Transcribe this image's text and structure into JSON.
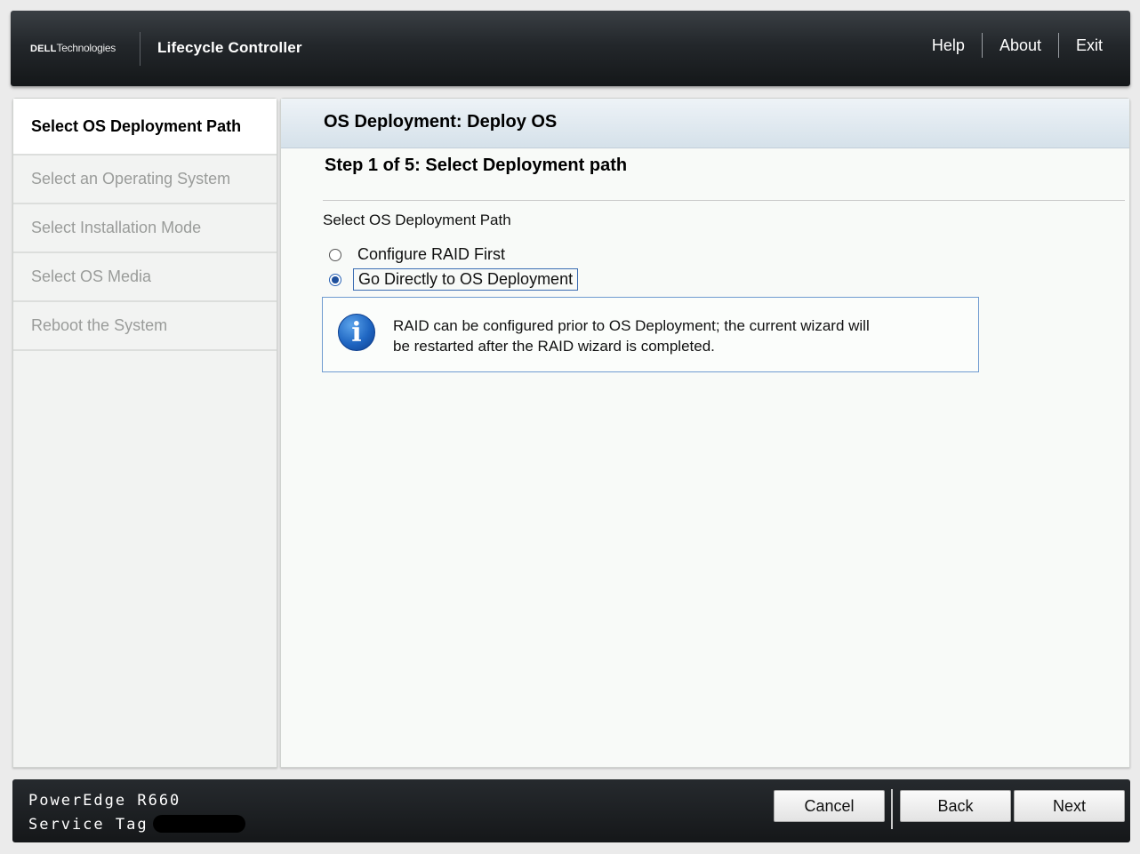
{
  "header": {
    "brand_dell": "DELL",
    "brand_tech": "Technologies",
    "app_title": "Lifecycle Controller",
    "links": [
      "Help",
      "About",
      "Exit"
    ]
  },
  "sidebar": {
    "steps": [
      {
        "label": "Select OS Deployment Path",
        "active": true
      },
      {
        "label": "Select an Operating System",
        "active": false
      },
      {
        "label": "Select Installation Mode",
        "active": false
      },
      {
        "label": "Select OS Media",
        "active": false
      },
      {
        "label": "Reboot the System",
        "active": false
      }
    ]
  },
  "main": {
    "title": "OS Deployment: Deploy OS",
    "step_heading": "Step 1 of 5: Select Deployment path",
    "section_label": "Select OS Deployment Path",
    "options": [
      {
        "label": "Configure RAID First",
        "selected": false
      },
      {
        "label": "Go Directly to OS Deployment",
        "selected": true
      }
    ],
    "info": {
      "icon": "info-icon",
      "line1": "RAID can be configured prior to OS Deployment; the current wizard will",
      "line2": "be restarted after the RAID wizard is completed."
    }
  },
  "footer": {
    "model": "PowerEdge R660",
    "service_tag_label": "Service Tag :",
    "buttons": {
      "cancel": "Cancel",
      "back": "Back",
      "next": "Next"
    }
  }
}
